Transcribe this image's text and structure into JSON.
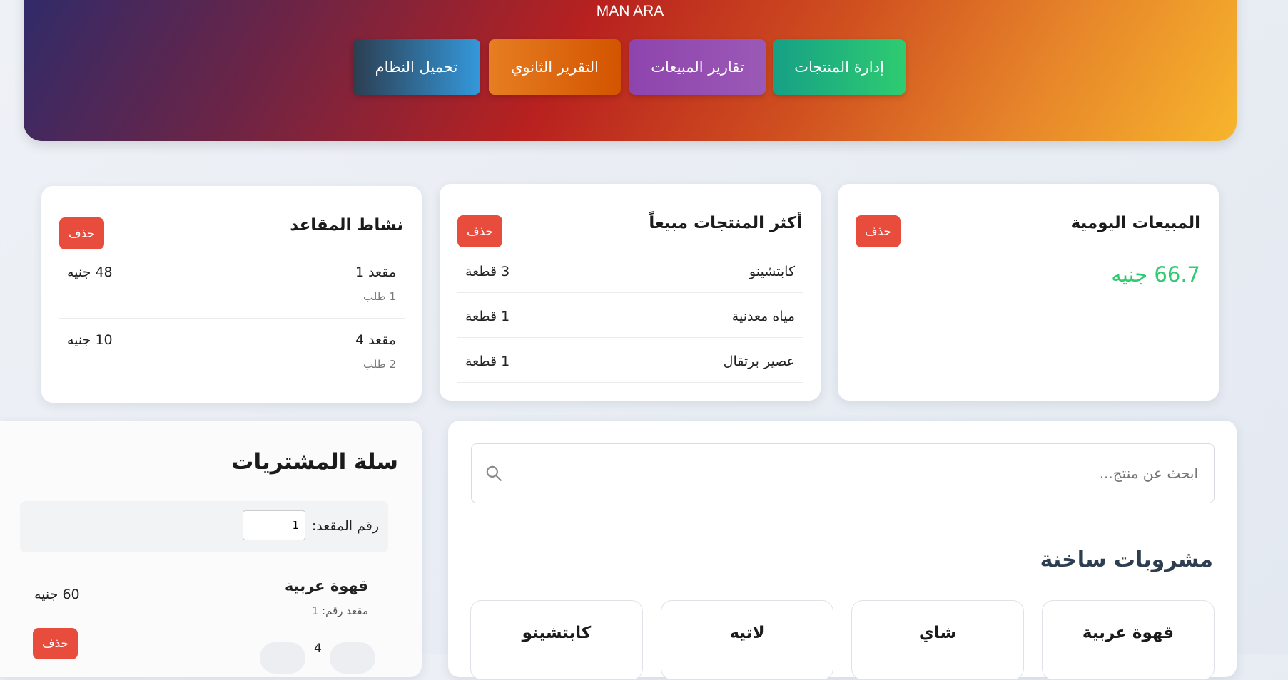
{
  "header": {
    "title": "MAN ARA",
    "nav": [
      {
        "label": "إدارة المنتجات"
      },
      {
        "label": "تقارير المبيعات"
      },
      {
        "label": "التقرير الثانوي"
      },
      {
        "label": "تحميل النظام"
      }
    ]
  },
  "daily_sales": {
    "title": "المبيعات اليومية",
    "delete_label": "حذف",
    "amount": "66.7 جنيه"
  },
  "top_products": {
    "title": "أكثر المنتجات مبيعاً",
    "delete_label": "حذف",
    "items": [
      {
        "name": "كابتشينو",
        "qty": "3 قطعة"
      },
      {
        "name": "مياه معدنية",
        "qty": "1 قطعة"
      },
      {
        "name": "عصير برتقال",
        "qty": "1 قطعة"
      }
    ]
  },
  "seat_activity": {
    "title": "نشاط المقاعد",
    "delete_label": "حذف",
    "items": [
      {
        "seat": "مقعد 1",
        "orders": "1 طلب",
        "amount": "48 جنيه"
      },
      {
        "seat": "مقعد 4",
        "orders": "2 طلب",
        "amount": "10 جنيه"
      }
    ]
  },
  "search": {
    "placeholder": "ابحث عن منتج..."
  },
  "category": {
    "title": "مشروبات ساخنة",
    "products": [
      "قهوة عربية",
      "شاي",
      "لاتيه",
      "كابتشينو"
    ]
  },
  "cart": {
    "title": "سلة المشتريات",
    "seat_label": "رقم المقعد:",
    "seat_value": "1",
    "item": {
      "name": "قهوة عربية",
      "seat": "مقعد رقم: 1",
      "price": "60 جنيه",
      "qty": "4",
      "delete_label": "حذف"
    }
  },
  "colors": {
    "accent_green": "#2ecc71",
    "danger_red": "#e74c3c"
  }
}
